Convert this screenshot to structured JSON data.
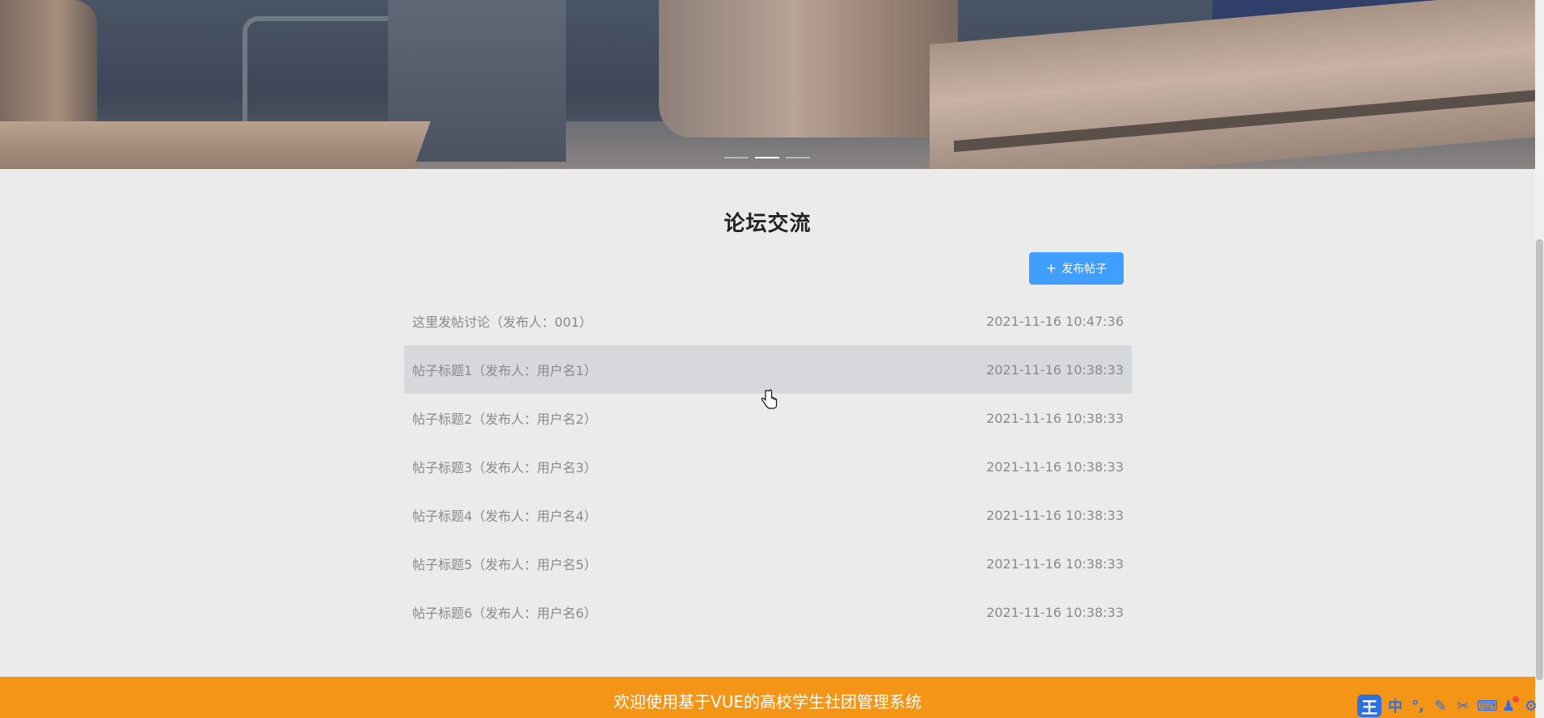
{
  "banner": {
    "slides": 3,
    "active_slide": 2
  },
  "forum": {
    "title": "论坛交流",
    "post_button_label": "发布帖子",
    "posts": [
      {
        "title": "这里发帖讨论（发布人：001）",
        "time": "2021-11-16 10:47:36"
      },
      {
        "title": "帖子标题1（发布人：用户名1）",
        "time": "2021-11-16 10:38:33"
      },
      {
        "title": "帖子标题2（发布人：用户名2）",
        "time": "2021-11-16 10:38:33"
      },
      {
        "title": "帖子标题3（发布人：用户名3）",
        "time": "2021-11-16 10:38:33"
      },
      {
        "title": "帖子标题4（发布人：用户名4）",
        "time": "2021-11-16 10:38:33"
      },
      {
        "title": "帖子标题5（发布人：用户名5）",
        "time": "2021-11-16 10:38:33"
      },
      {
        "title": "帖子标题6（发布人：用户名6）",
        "time": "2021-11-16 10:38:33"
      }
    ]
  },
  "footer": {
    "text": "欢迎使用基于VUE的高校学生社团管理系统"
  },
  "ime": {
    "logo": "王",
    "mode": "中",
    "punct": "°,",
    "items": [
      "pen-icon",
      "scissors-icon",
      "keyboard-icon",
      "shirt-icon",
      "gear-icon"
    ]
  },
  "colors": {
    "accent": "#409eff",
    "footer": "#f49517",
    "background": "#ebebeb",
    "hover_row": "#d7d8dc",
    "text_muted": "#8a8a8a"
  }
}
